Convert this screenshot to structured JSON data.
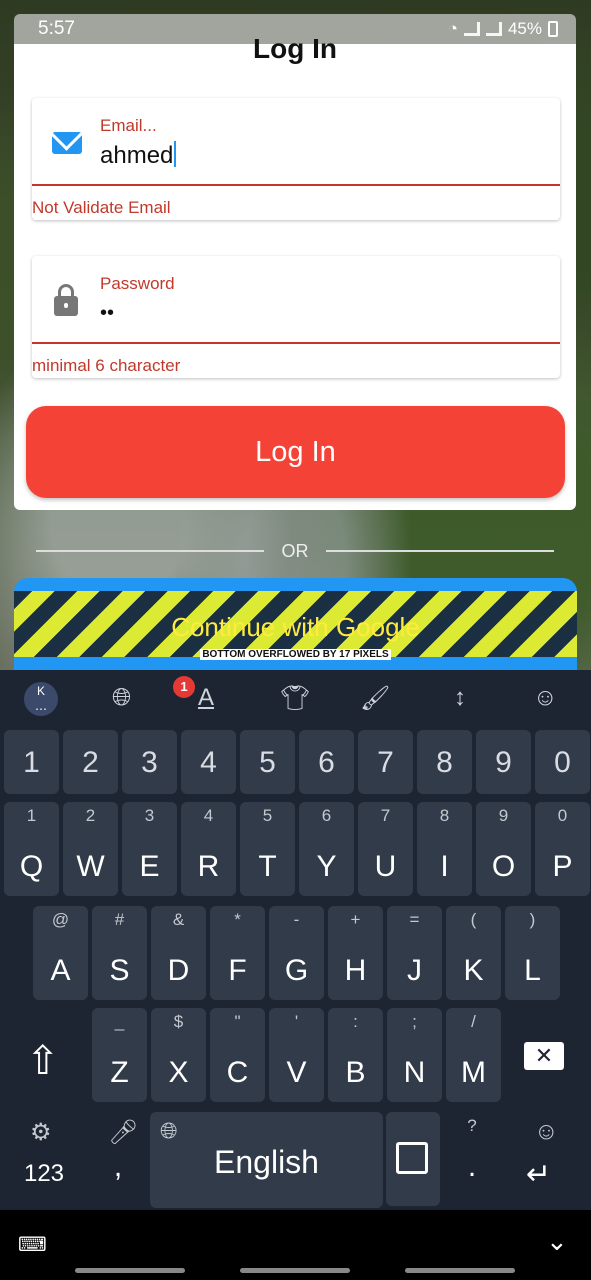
{
  "status": {
    "time": "5:57",
    "battery": "45%"
  },
  "form": {
    "title": "Log In",
    "email": {
      "label": "Email...",
      "value": "ahmed",
      "error": "Not Validate Email"
    },
    "password": {
      "label": "Password",
      "value": "••",
      "error": "minimal 6 character"
    },
    "login_label": "Log In"
  },
  "divider": {
    "text": "OR"
  },
  "google": {
    "label": "Continue with Google",
    "overflow": "BOTTOM OVERFLOWED BY 17 PIXELS"
  },
  "keyboard": {
    "toolbar": {
      "logo": "K",
      "badge": "1"
    },
    "num_row": [
      "1",
      "2",
      "3",
      "4",
      "5",
      "6",
      "7",
      "8",
      "9",
      "0"
    ],
    "row1": [
      {
        "sub": "1",
        "key": "Q"
      },
      {
        "sub": "2",
        "key": "W"
      },
      {
        "sub": "3",
        "key": "E"
      },
      {
        "sub": "4",
        "key": "R"
      },
      {
        "sub": "5",
        "key": "T"
      },
      {
        "sub": "6",
        "key": "Y"
      },
      {
        "sub": "7",
        "key": "U"
      },
      {
        "sub": "8",
        "key": "I"
      },
      {
        "sub": "9",
        "key": "O"
      },
      {
        "sub": "0",
        "key": "P"
      }
    ],
    "row2": [
      {
        "sub": "@",
        "key": "A"
      },
      {
        "sub": "#",
        "key": "S"
      },
      {
        "sub": "&",
        "key": "D"
      },
      {
        "sub": "*",
        "key": "F"
      },
      {
        "sub": "-",
        "key": "G"
      },
      {
        "sub": "+",
        "key": "H"
      },
      {
        "sub": "=",
        "key": "J"
      },
      {
        "sub": "(",
        "key": "K"
      },
      {
        "sub": ")",
        "key": "L"
      }
    ],
    "row3": [
      {
        "sub": "_",
        "key": "Z"
      },
      {
        "sub": "$",
        "key": "X"
      },
      {
        "sub": "\"",
        "key": "C"
      },
      {
        "sub": "'",
        "key": "V"
      },
      {
        "sub": ":",
        "key": "B"
      },
      {
        "sub": ";",
        "key": "N"
      },
      {
        "sub": "/",
        "key": "M"
      }
    ],
    "num_label": "123",
    "comma": ",",
    "space_label": "English",
    "period": ".",
    "period_sub": "?"
  }
}
